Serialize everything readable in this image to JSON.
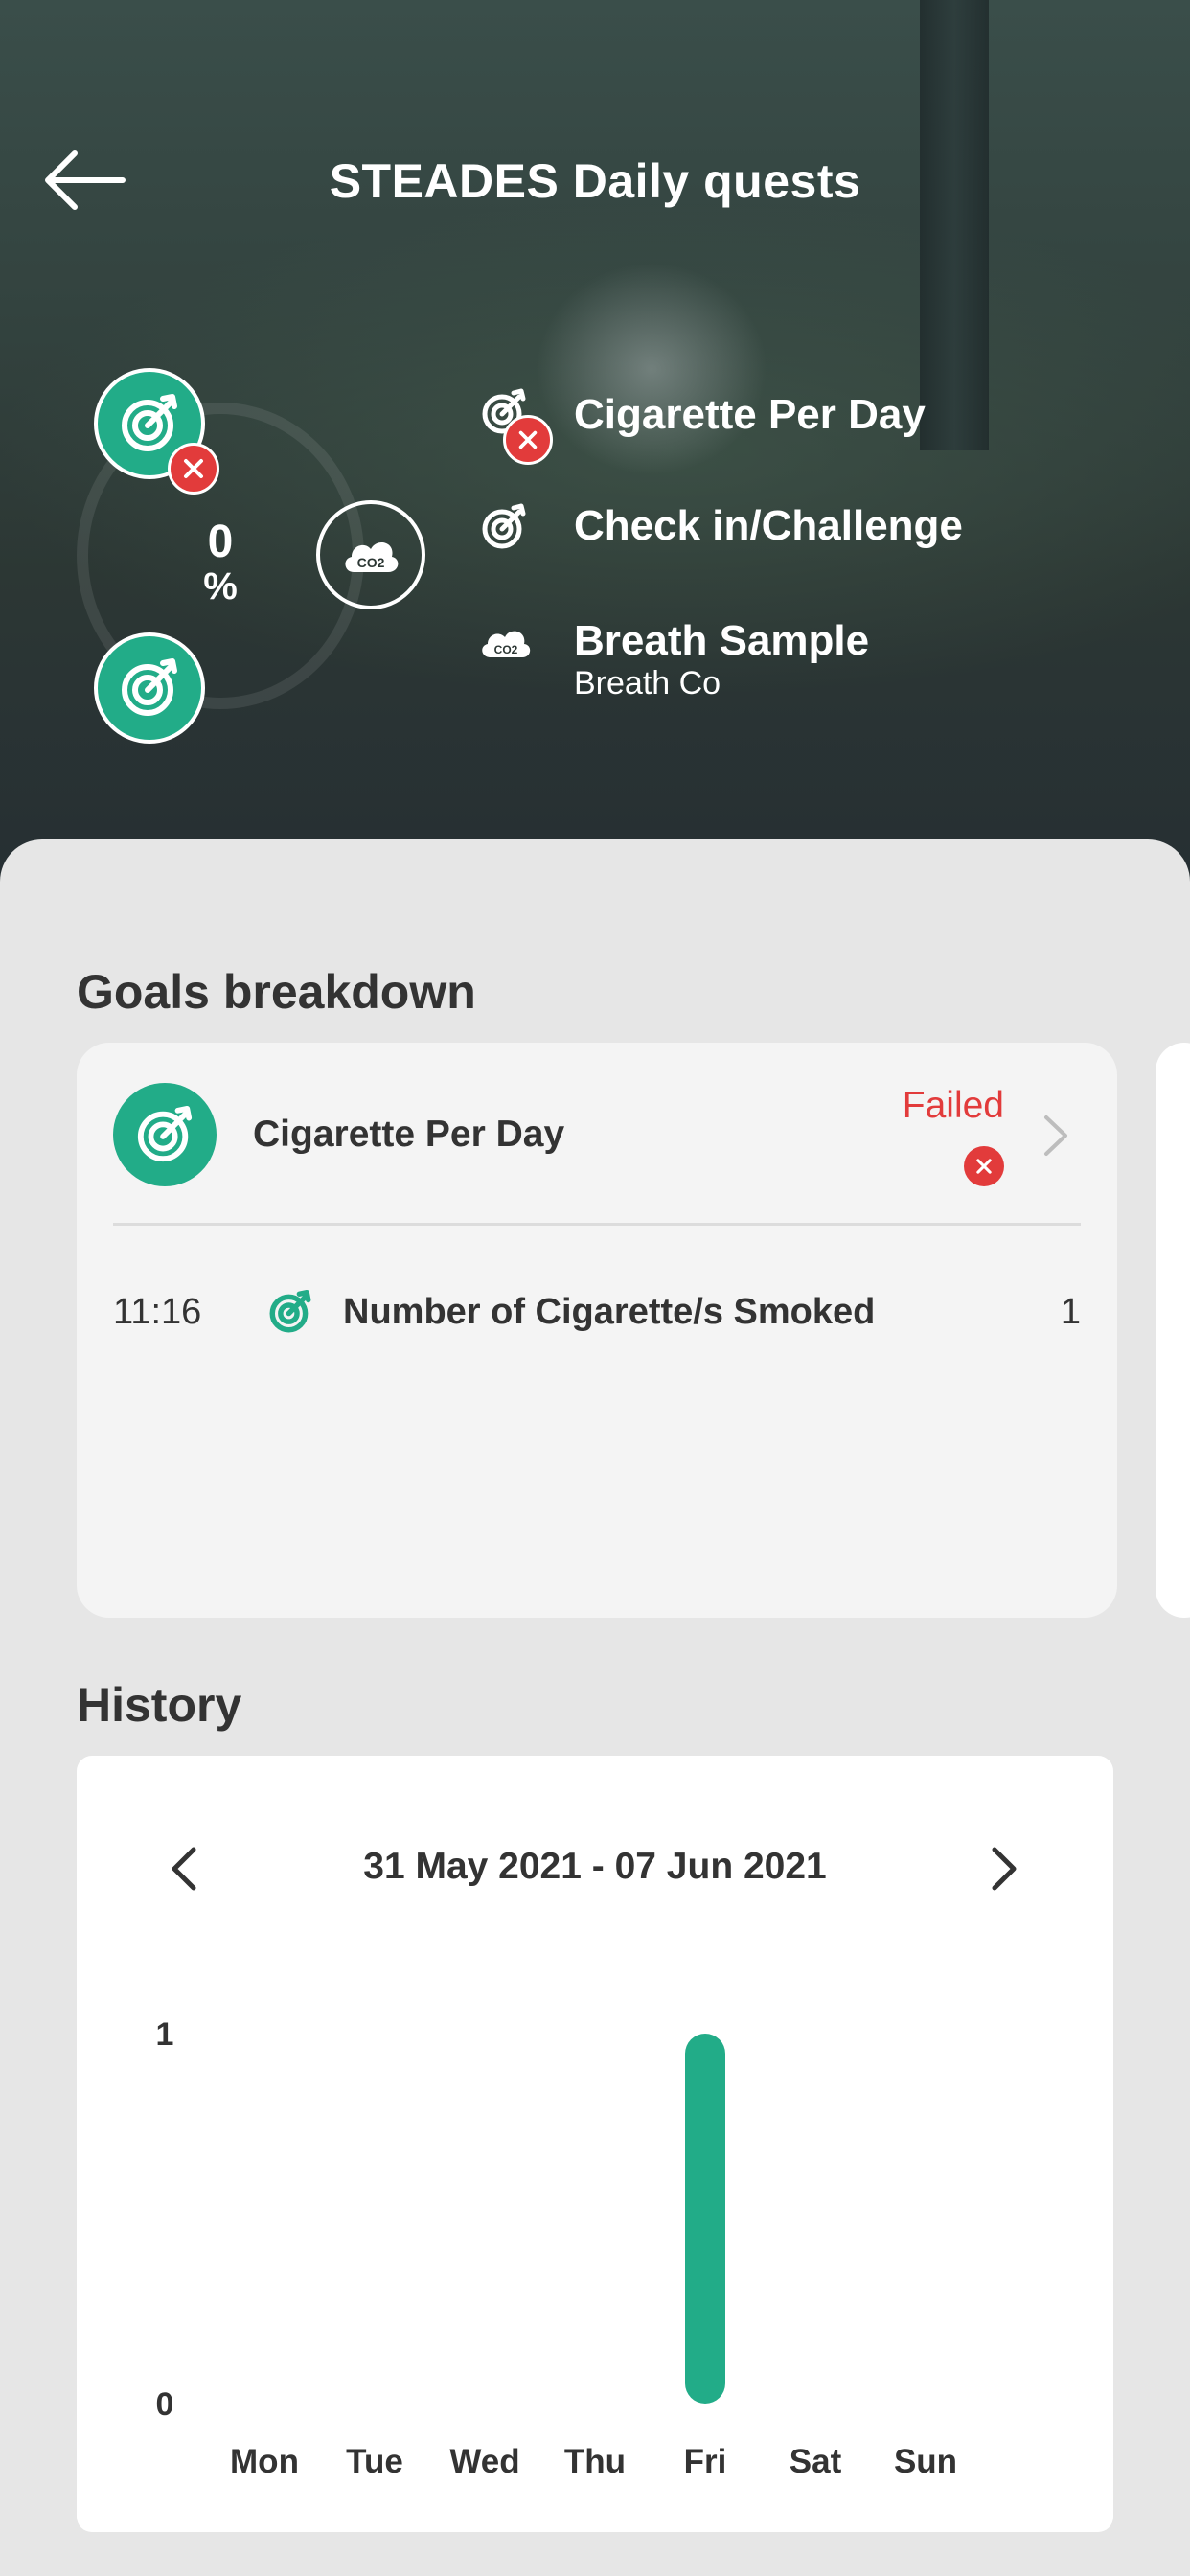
{
  "header": {
    "title": "STEADES Daily quests",
    "progress_value": "0",
    "progress_unit": "%",
    "legend": [
      {
        "label": "Cigarette Per Day",
        "sublabel": "",
        "icon": "target-failed-icon"
      },
      {
        "label": "Check in/Challenge",
        "sublabel": "",
        "icon": "target-icon"
      },
      {
        "label": "Breath Sample",
        "sublabel": "Breath Co",
        "icon": "co2-cloud-icon"
      }
    ],
    "co2_icon_text": "CO2"
  },
  "goals": {
    "title": "Goals breakdown",
    "card": {
      "name": "Cigarette Per Day",
      "status": "Failed",
      "status_color": "#e23b3b",
      "entries": [
        {
          "time": "11:16",
          "label": "Number of Cigarette/s Smoked",
          "count": "1"
        }
      ]
    }
  },
  "history": {
    "title": "History",
    "date_range": "31 May 2021 - 07 Jun 2021"
  },
  "colors": {
    "accent": "#22ac88",
    "error": "#e23b3b"
  },
  "chart_data": {
    "type": "bar",
    "categories": [
      "Mon",
      "Tue",
      "Wed",
      "Thu",
      "Fri",
      "Sat",
      "Sun"
    ],
    "values": [
      0,
      0,
      0,
      0,
      1,
      0,
      0
    ],
    "ylim": [
      0,
      1
    ],
    "yticks": [
      "0",
      "1"
    ],
    "xlabel": "",
    "ylabel": "",
    "bar_color": "#22ac88",
    "grid": false
  }
}
